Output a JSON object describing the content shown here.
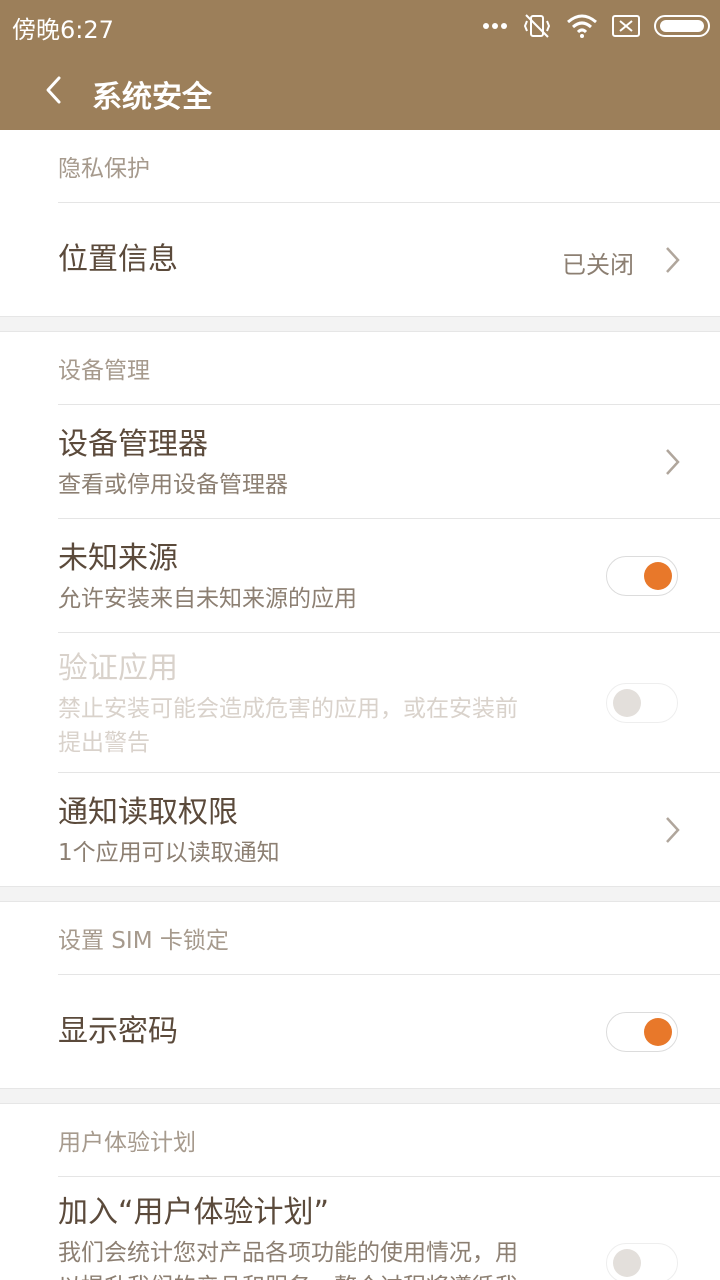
{
  "status_bar": {
    "time": "傍晚6:27"
  },
  "app_bar": {
    "title": "系统安全"
  },
  "sections": {
    "privacy": {
      "header": "隐私保护",
      "location": {
        "title": "位置信息",
        "value": "已关闭"
      }
    },
    "device": {
      "header": "设备管理",
      "device_admin": {
        "title": "设备管理器",
        "subtitle": "查看或停用设备管理器"
      },
      "unknown_sources": {
        "title": "未知来源",
        "subtitle": "允许安装来自未知来源的应用",
        "state": "on"
      },
      "verify_apps": {
        "title": "验证应用",
        "subtitle_line1": "禁止安装可能会造成危害的应用，或在安装前",
        "subtitle_line2": "提出警告",
        "state": "off",
        "enabled": false
      },
      "notification_access": {
        "title": "通知读取权限",
        "subtitle": "1个应用可以读取通知"
      }
    },
    "sim": {
      "header": "设置 SIM 卡锁定",
      "show_password": {
        "title": "显示密码",
        "state": "on"
      }
    },
    "ux": {
      "header": "用户体验计划",
      "join": {
        "title": "加入“用户体验计划”",
        "subtitle_line1": "我们会统计您对产品各项功能的使用情况，用",
        "subtitle_line2": "以提升我们的产品和服务，整个过程将遵循我",
        "state": "off"
      }
    }
  },
  "colors": {
    "accent": "#9c7f5a",
    "toggle_on": "#e8782a"
  },
  "icons": {
    "back": "back-arrow-icon",
    "chevron": "chevron-right-icon"
  }
}
